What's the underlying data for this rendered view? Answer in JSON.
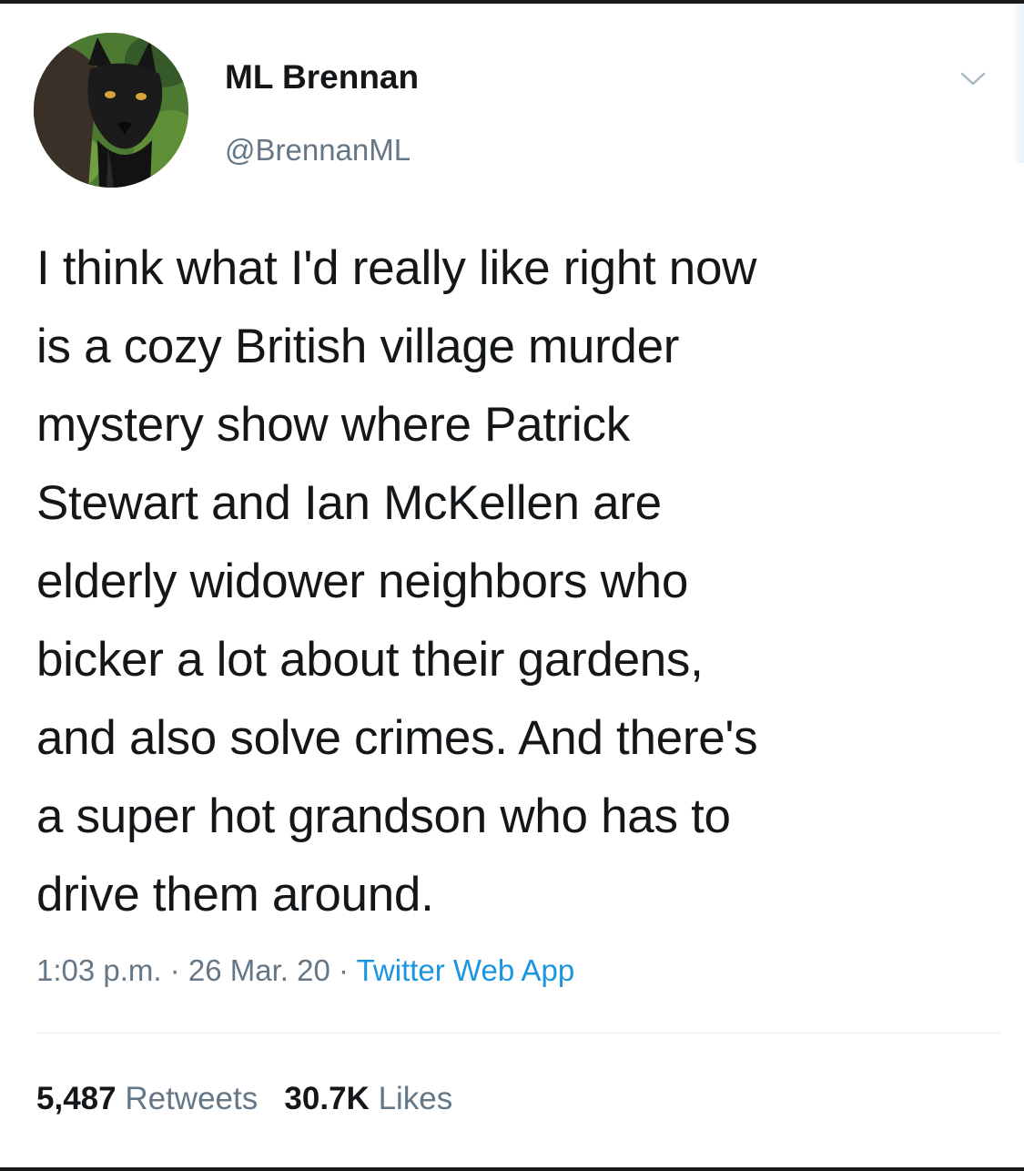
{
  "user": {
    "display_name": "ML Brennan",
    "handle": "@BrennanML"
  },
  "tweet": {
    "text": "I think what I'd really like right now\nis a cozy British village murder\nmystery show where Patrick\nStewart and Ian McKellen are\nelderly widower neighbors who\nbicker a lot about their gardens,\nand also solve crimes. And there's\na super hot grandson who has to\ndrive them around.",
    "time": "1:03 p.m.",
    "separator": " · ",
    "date": "26 Mar. 20",
    "source": "Twitter Web App"
  },
  "stats": {
    "retweets_count": "5,487",
    "retweets_label": "Retweets",
    "likes_count": "30.7K",
    "likes_label": "Likes"
  },
  "icons": {
    "avatar": "black-fox-photo",
    "menu": "chevron-down-icon"
  },
  "colors": {
    "text": "#14171a",
    "secondary": "#657786",
    "link": "#1b95e0"
  }
}
